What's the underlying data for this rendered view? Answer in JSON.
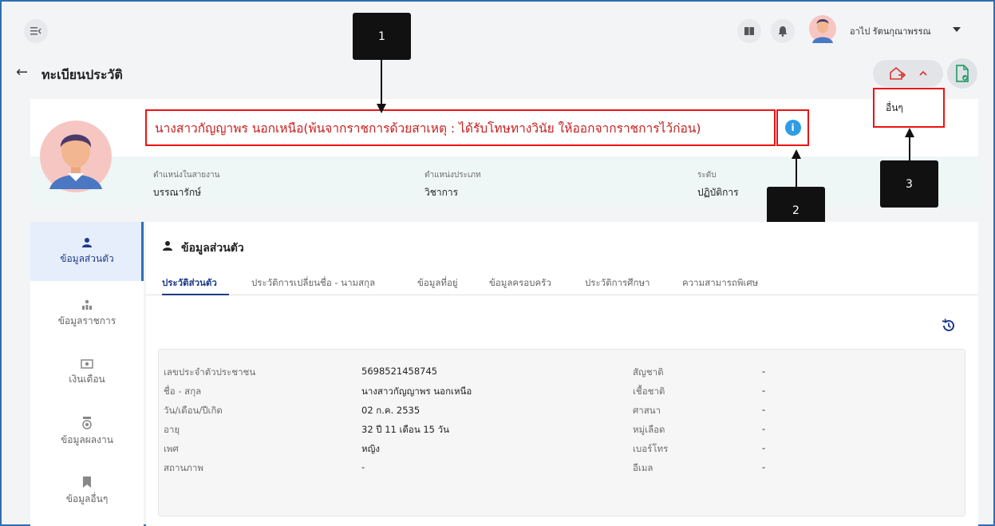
{
  "header": {
    "user_name": "อาไป รัตนกุณาพรรณ",
    "icons": [
      "menu-collapse-icon",
      "book-icon",
      "bell-icon",
      "chevron-down-icon"
    ]
  },
  "page": {
    "title": "ทะเบียนประวัติ"
  },
  "profile": {
    "name_status": "นางสาวกัญญาพร นอกเหนือ(พ้นจากราชการด้วยสาเหตุ : ได้รับโทษทางวินัย ให้ออกจากราชการไว้ก่อน)",
    "fields": [
      {
        "label": "ตำแหน่งในสายงาน",
        "value": "บรรณารักษ์"
      },
      {
        "label": "ตำแหน่งประเภท",
        "value": "วิชาการ"
      },
      {
        "label": "ระดับ",
        "value": "ปฏิบัติการ"
      }
    ]
  },
  "dropdown": {
    "item": "อื่นๆ"
  },
  "callouts": {
    "c1": "1",
    "c2": "2",
    "c3": "3"
  },
  "sidebar": {
    "items": [
      {
        "label": "ข้อมูลส่วนตัว",
        "icon": "person-icon"
      },
      {
        "label": "ข้อมูลราชการ",
        "icon": "org-icon"
      },
      {
        "label": "เงินเดือน",
        "icon": "money-icon"
      },
      {
        "label": "ข้อมูลผลงาน",
        "icon": "medal-icon"
      },
      {
        "label": "ข้อมูลอื่นๆ",
        "icon": "bookmark-icon"
      }
    ]
  },
  "main": {
    "section_title": "ข้อมูลส่วนตัว",
    "tabs": [
      "ประวัติส่วนตัว",
      "ประวัติการเปลี่ยนชื่อ - นามสกุล",
      "ข้อมูลที่อยู่",
      "ข้อมูลครอบครัว",
      "ประวัติการศึกษา",
      "ความสามารถพิเศษ"
    ],
    "left_rows": [
      {
        "label": "เลขประจำตัวประชาชน",
        "value": "5698521458745"
      },
      {
        "label": "ชื่อ - สกุล",
        "value": "นางสาวกัญญาพร นอกเหนือ"
      },
      {
        "label": "วัน/เดือน/ปีเกิด",
        "value": "02 ก.ค. 2535"
      },
      {
        "label": "อายุ",
        "value": "32 ปี 11 เดือน 15 วัน"
      },
      {
        "label": "เพศ",
        "value": "หญิง"
      },
      {
        "label": "สถานภาพ",
        "value": "-"
      }
    ],
    "right_rows": [
      {
        "label": "สัญชาติ",
        "value": "-"
      },
      {
        "label": "เชื้อชาติ",
        "value": "-"
      },
      {
        "label": "ศาสนา",
        "value": "-"
      },
      {
        "label": "หมู่เลือด",
        "value": "-"
      },
      {
        "label": "เบอร์โทร",
        "value": "-"
      },
      {
        "label": "อีเมล",
        "value": "-"
      }
    ]
  },
  "colors": {
    "accent": "#1e3a8a",
    "alert": "#c81e1e",
    "info": "#2f9de3"
  }
}
